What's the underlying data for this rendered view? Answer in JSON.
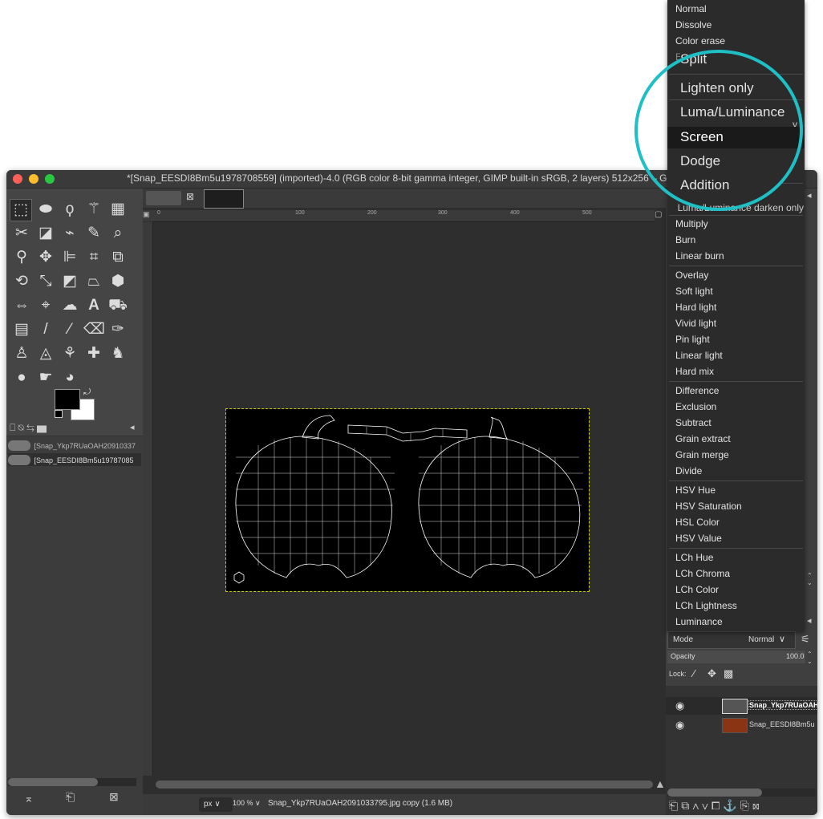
{
  "window": {
    "title": "*[Snap_EESDI8Bm5u1978708559] (imported)-4.0 (RGB color 8-bit gamma integer, GIMP built-in sRGB, 2 layers) 512x256 – GIMP"
  },
  "ruler": {
    "ticks": [
      "0",
      "100",
      "200",
      "300",
      "400",
      "500"
    ]
  },
  "left_layers": [
    {
      "label": "[Snap_Ykp7RUaOAH20910337"
    },
    {
      "label": "[Snap_EESDI8Bm5u19787085"
    }
  ],
  "status": {
    "unit": "px",
    "zoom": "100 %",
    "file": "Snap_Ykp7RUaOAH2091033795.jpg copy (1.6 MB)"
  },
  "layers_panel": {
    "mode_label": "Mode",
    "mode_value": "Normal",
    "opacity_label": "Opacity",
    "opacity_value": "100.0",
    "lock_label": "Lock:",
    "layers": [
      {
        "name": "Snap_Ykp7RUaOAH"
      },
      {
        "name": "Snap_EESDI8Bm5u"
      }
    ]
  },
  "mode_menu": {
    "group1": [
      "Normal",
      "Dissolve",
      "Color erase",
      "Erase"
    ],
    "zoom_items": [
      "Split",
      "Lighten only",
      "Luma/Luminance",
      "Screen",
      "Dodge",
      "Addition"
    ],
    "partial_right": [
      "y",
      "Luma/Luminance darken only"
    ],
    "group3": [
      "Multiply",
      "Burn",
      "Linear burn"
    ],
    "group4": [
      "Overlay",
      "Soft light",
      "Hard light",
      "Vivid light",
      "Pin light",
      "Linear light",
      "Hard mix"
    ],
    "group5": [
      "Difference",
      "Exclusion",
      "Subtract",
      "Grain extract",
      "Grain merge",
      "Divide"
    ],
    "group6": [
      "HSV Hue",
      "HSV Saturation",
      "HSL Color",
      "HSV Value"
    ],
    "group7": [
      "LCh Hue",
      "LCh Chroma",
      "LCh Color",
      "LCh Lightness",
      "Luminance"
    ],
    "highlighted": "Screen"
  },
  "colors": {
    "accent_circle": "#1fbfc6",
    "menu_bg": "#2b2b2b"
  }
}
